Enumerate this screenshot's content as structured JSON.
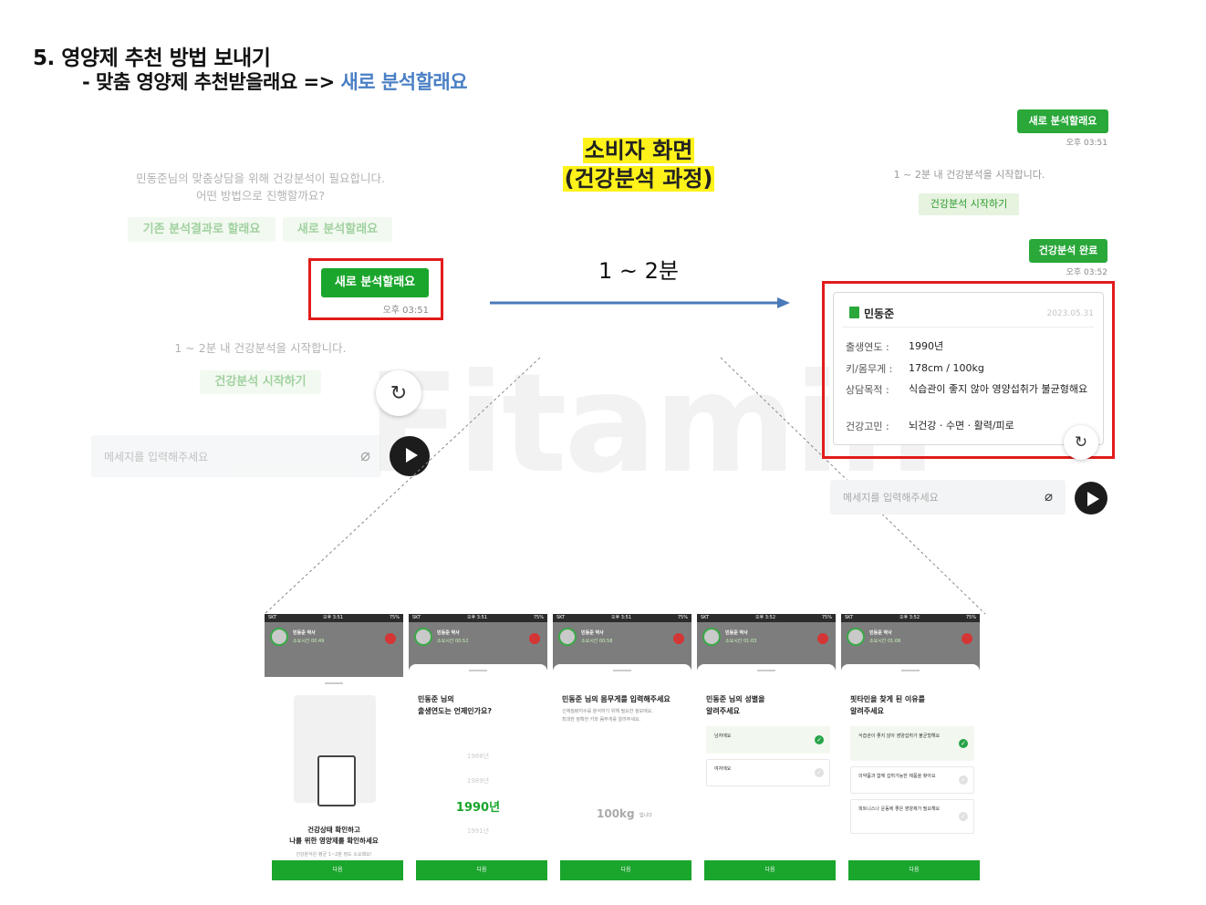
{
  "heading": {
    "line1": "5. 영양제 추천 방법 보내기",
    "line2_prefix": "- 맞춤 영양제 추천받을래요 => ",
    "line2_highlight": "새로 분석할래요"
  },
  "center": {
    "title_line1": "소비자 화면",
    "title_line2": "(건강분석 과정)",
    "duration": "1 ~ 2분"
  },
  "watermark": "Fitamin",
  "left_chat": {
    "prompt_line1": "민동준님의 맞춤상담을 위해 건강분석이 필요합니다.",
    "prompt_line2": "어떤 방법으로 진행할까요?",
    "option_existing": "기존 분석결과로 할래요",
    "option_new": "새로 분석할래요",
    "selected_reply": "새로 분석할래요",
    "reply_time": "오후 03:51",
    "info": "1 ~ 2분 내 건강분석을 시작합니다.",
    "start_button": "건강분석 시작하기",
    "input_placeholder": "메세지를 입력해주세요"
  },
  "right_chat": {
    "reply_top": "새로 분석할래요",
    "reply_top_time": "오후 03:51",
    "info": "1 ~ 2분 내 건강분석을 시작합니다.",
    "start_button": "건강분석 시작하기",
    "done_reply": "건강분석 완료",
    "done_time": "오후 03:52",
    "card": {
      "name": "민동준",
      "date": "2023.05.31",
      "rows": [
        {
          "label": "출생연도 :",
          "value": "1990년"
        },
        {
          "label": "키/몸무게 :",
          "value": "178cm / 100kg"
        },
        {
          "label": "상담목적 :",
          "value": "식습관이 좋지 않아 영양섭취가 불균형해요"
        },
        {
          "label": "건강고민 :",
          "value": "뇌건강 · 수면 · 활력/피로"
        }
      ]
    },
    "input_placeholder": "메세지를 입력해주세요"
  },
  "phones": {
    "status_carrier": "SKT",
    "status_battery": "75%",
    "doctor": "민동준 약사",
    "next_label": "다음",
    "screens": [
      {
        "clock": "오후 3:51",
        "timer": "소요시간 00:49",
        "title_line1": "건강상태 확인하고",
        "title_line2": "나를 위한 영양제를 확인하세요",
        "sub": "건강분석은 평균 1~2분 정도 소요돼요!"
      },
      {
        "clock": "오후 3:51",
        "timer": "소요시간 00:52",
        "q1": "민동준 님의",
        "q2": "출생연도는 언제인가요?",
        "years": [
          "1988년",
          "1989년",
          "1990년",
          "1991년"
        ]
      },
      {
        "clock": "오후 3:51",
        "timer": "소요시간 00:58",
        "q1": "민동준 님의 몸무게를 입력해주세요",
        "sub1": "신체질량지수를 분석하기 위해 필요한 정보에요.",
        "sub2": "최대한 정확한 키와 몸무게를 알려주세요.",
        "weight": "100kg",
        "unit": "입니다"
      },
      {
        "clock": "오후 3:52",
        "timer": "소요시간 01:03",
        "q1": "민동준 님의 성별을",
        "q2": "알려주세요",
        "opt1": "남자에요",
        "opt2": "여자에요"
      },
      {
        "clock": "오후 3:52",
        "timer": "소요시간 01:06",
        "q1": "핏타민을 찾게 된 이유를",
        "q2": "알려주세요",
        "opt1": "식습관이 좋지 않아 영양섭취가 불균형해요",
        "opt2": "의약품과 함께 섭취가능한 제품을 찾아요",
        "opt3": "피트니스나 운동에 좋은 영양제가 필요해요"
      }
    ]
  },
  "colors": {
    "accent_green": "#1aa52c",
    "highlight_red": "#e21b1b",
    "arrow_blue": "#4a7ab8",
    "title_yellow": "#fff21a",
    "link_blue": "#4a7fc4"
  }
}
